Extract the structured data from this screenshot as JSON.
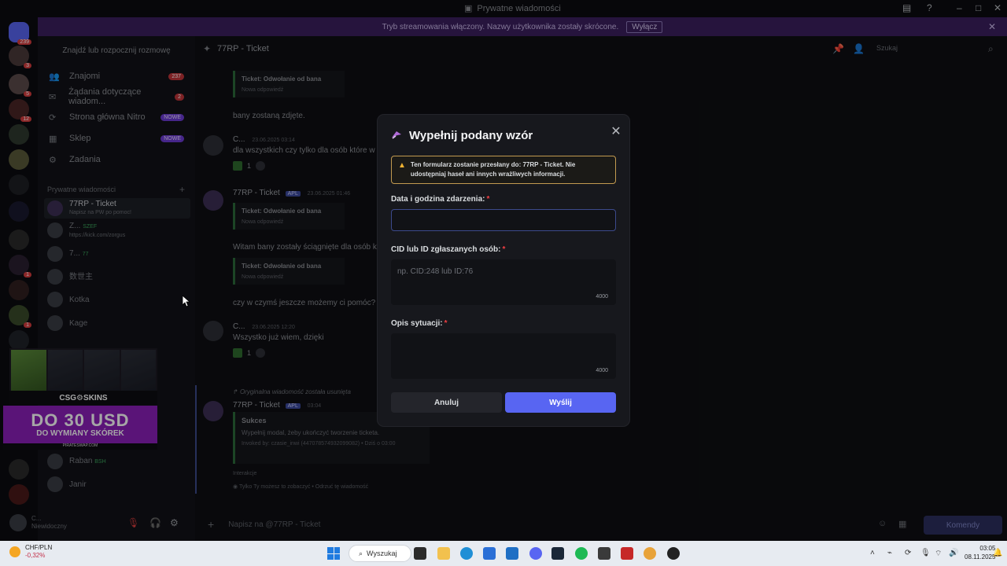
{
  "window": {
    "title": "Prywatne wiadomości"
  },
  "banner": {
    "text": "Tryb streamowania włączony. Nazwy użytkownika zostały skrócone.",
    "button": "Wyłącz"
  },
  "rail": {
    "home_badge": "239",
    "badges": [
      "3",
      "5",
      "12",
      "1",
      "1"
    ]
  },
  "sidebar": {
    "search_placeholder": "Znajdź lub rozpocznij rozmowę",
    "nav": [
      {
        "label": "Znajomi",
        "badge": "237"
      },
      {
        "label": "Żądania dotyczące wiadom...",
        "badge": "2"
      },
      {
        "label": "Strona główna Nitro",
        "badge": "NOWE"
      },
      {
        "label": "Sklep",
        "badge": "NOWE"
      },
      {
        "label": "Zadania",
        "badge": ""
      }
    ],
    "dm_header": "Prywatne wiadomości",
    "dms": [
      {
        "name": "77RP - Ticket",
        "sub": "Napisz na PW po pomoc!"
      },
      {
        "name": "Z...",
        "tag": "SZEF",
        "sub": "https://kick.com/zorgus"
      },
      {
        "name": "7...",
        "tag": "77",
        "sub": ""
      },
      {
        "name": "数世主",
        "sub": ""
      },
      {
        "name": "Kotka",
        "sub": ""
      },
      {
        "name": "Kage",
        "sub": ""
      },
      {
        "name": "Bub☺☺☺",
        "sub": ""
      },
      {
        "name": "Raban",
        "tag": "BSH",
        "sub": ""
      },
      {
        "name": "Janir",
        "sub": ""
      }
    ]
  },
  "ad": {
    "brand": "CSG⚙SKINS",
    "cards": [
      "Combat",
      "Bad Trip",
      "Wave Breaker"
    ],
    "promo_big": "DO 30 USD",
    "promo_small": "DO WYMIANY SKÓREK",
    "footer": "PIRATESWAP.COM"
  },
  "user": {
    "name": "C...",
    "status": "Niewidoczny"
  },
  "chat": {
    "channel": "77RP - Ticket",
    "search_placeholder": "Szukaj",
    "messages": [
      {
        "text": "bany zostaną zdjęte."
      },
      {
        "author": "C...",
        "time": "23.06.2025 03:14",
        "text": "dla wszystkich czy tylko dla osób które w"
      },
      {
        "author": "77RP - Ticket",
        "tag": "APL",
        "time": "23.06.2025 01:46",
        "text": "Witam bany zostały ściągnięte dla osób k"
      },
      {
        "text": "czy w czymś jeszcze możemy ci pomóc?"
      },
      {
        "author": "C...",
        "time": "23.06.2025 12:20",
        "text": "Wszystko już wiem, dzięki"
      },
      {
        "reply_note": "Oryginalna wiadomość została usunięta",
        "author": "77RP - Ticket",
        "tag": "APL",
        "time": "03:04"
      }
    ],
    "embed_title": "Ticket: Odwołanie od bana",
    "embed_sub": "Nowa odpowiedź",
    "reaction_count": "1",
    "success": {
      "title": "Sukces",
      "text": "Wypełnij modal, żeby ukończyć tworzenie ticketa.",
      "invoked": "Invoked by: czasie_inwi (447078574932099082) • Dziś o 03:00"
    },
    "only_you": "Tylko Ty możesz to zobaczyć • Odrzuć tę wiadomość",
    "interaction_label": "Interakcje",
    "composer_placeholder": "Napisz na @77RP - Ticket",
    "send_label": "Komendy"
  },
  "modal": {
    "title": "Wypełnij podany wzór",
    "warning": "Ten formularz zostanie przesłany do: 77RP - Ticket. Nie udostępniaj haseł ani innych wrażliwych informacji.",
    "field1_label": "Data i godzina zdarzenia:",
    "field2_label": "CID lub ID zgłaszanych osób:",
    "field2_placeholder": "np. CID:248 lub ID:76",
    "field2_count": "4000",
    "field3_label": "Opis sytuacji:",
    "field3_count": "4000",
    "required_mark": "*",
    "cancel": "Anuluj",
    "submit": "Wyślij"
  },
  "taskbar": {
    "ticker": "CHF/PLN",
    "ticker_change": "-0,32%",
    "search": "Wyszukaj",
    "time": "03:05",
    "date": "08.11.2025"
  },
  "colors": {
    "accent": "#5865f2",
    "warning": "#f0b232",
    "banner": "#3b1f5e",
    "danger": "#f23f43"
  }
}
